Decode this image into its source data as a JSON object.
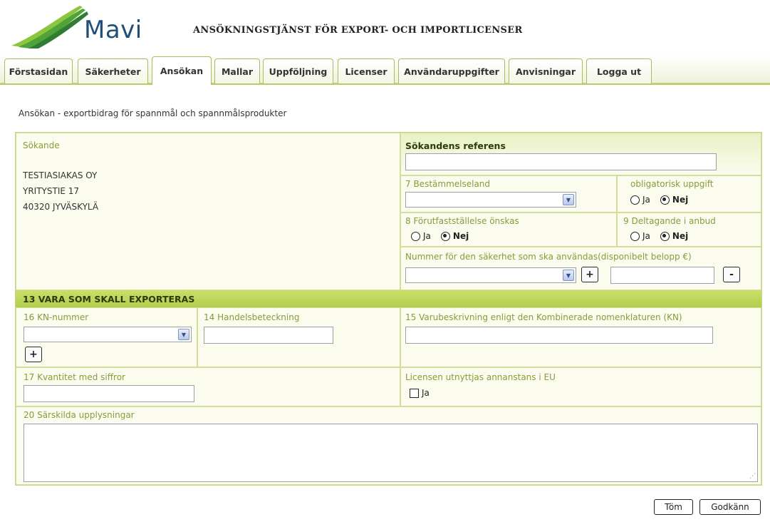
{
  "brand": {
    "logo_text": "Mavi"
  },
  "app_title": "ANSÖKNINGSTJÄNST FÖR EXPORT- OCH IMPORTLICENSER",
  "tabs": [
    {
      "label": "Förstasidan"
    },
    {
      "label": "Säkerheter"
    },
    {
      "label": "Ansökan"
    },
    {
      "label": "Mallar"
    },
    {
      "label": "Uppföljning"
    },
    {
      "label": "Licenser"
    },
    {
      "label": "Användaruppgifter"
    },
    {
      "label": "Anvisningar"
    },
    {
      "label": "Logga ut"
    }
  ],
  "active_tab": "Ansökan",
  "page_heading": "Ansökan - exportbidrag för spannmål och spannmålsprodukter",
  "applicant": {
    "label": "Sökande",
    "name": "TESTIASIAKAS OY",
    "street": "YRITYSTIE 17",
    "city": "40320  JYVÄSKYLÄ"
  },
  "reference": {
    "label": "Sökandens referens",
    "value": ""
  },
  "destination": {
    "label": "7 Bestämmelseland",
    "value": ""
  },
  "mandatory": {
    "label": "obligatorisk uppgift",
    "yes": "Ja",
    "no": "Nej",
    "selected": "Nej"
  },
  "advance_fixing": {
    "label": "8 Förutfastställelse önskas",
    "yes": "Ja",
    "no": "Nej",
    "selected": "Nej"
  },
  "tender": {
    "label": "9 Deltagande i anbud",
    "yes": "Ja",
    "no": "Nej",
    "selected": "Nej"
  },
  "security": {
    "label": "Nummer för den säkerhet som ska användas(disponibelt belopp €)",
    "add": "+",
    "remove": "-"
  },
  "section13": {
    "title": "13 VARA SOM SKALL EXPORTERAS"
  },
  "kn": {
    "label": "16 KN-nummer",
    "add": "+"
  },
  "trade_name": {
    "label": "14 Handelsbeteckning",
    "value": ""
  },
  "description": {
    "label": "15 Varubeskrivning enligt den Kombinerade nomenklaturen (KN)",
    "value": ""
  },
  "quantity": {
    "label": "17 Kvantitet med siffror",
    "value": ""
  },
  "eu_use": {
    "label": "Licensen utnyttjas annanstans i EU",
    "option": "Ja"
  },
  "special_info": {
    "label": "20 Särskilda upplysningar",
    "value": ""
  },
  "buttons": {
    "clear": "Töm",
    "approve": "Godkänn"
  },
  "colors": {
    "accent": "#b3cf4c",
    "label": "#8a9a3c",
    "brand": "#1f4e79"
  }
}
